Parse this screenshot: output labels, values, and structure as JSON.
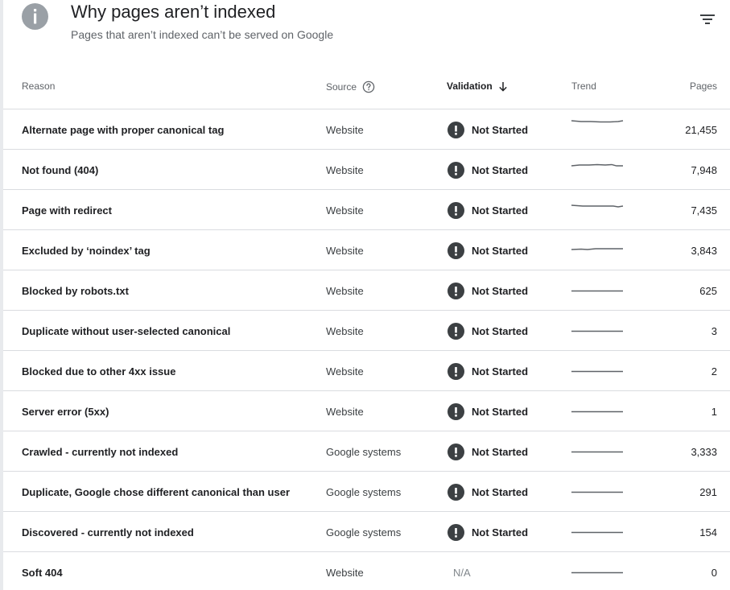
{
  "header": {
    "title": "Why pages aren’t indexed",
    "subtitle": "Pages that aren’t indexed can’t be served on Google",
    "info_icon": "info-icon",
    "filter_icon": "filter-icon"
  },
  "columns": {
    "reason": "Reason",
    "source": "Source",
    "validation": "Validation",
    "trend": "Trend",
    "pages": "Pages"
  },
  "colors": {
    "accent": "#202124",
    "muted": "#5f6368",
    "badge": "#3c4043",
    "icon_grey": "#9aa0a6",
    "divider": "#dadce0"
  },
  "rows": [
    {
      "reason": "Alternate page with proper canonical tag",
      "source": "Website",
      "validation": "Not Started",
      "pages": "21,455"
    },
    {
      "reason": "Not found (404)",
      "source": "Website",
      "validation": "Not Started",
      "pages": "7,948"
    },
    {
      "reason": "Page with redirect",
      "source": "Website",
      "validation": "Not Started",
      "pages": "7,435"
    },
    {
      "reason": "Excluded by ‘noindex’ tag",
      "source": "Website",
      "validation": "Not Started",
      "pages": "3,843"
    },
    {
      "reason": "Blocked by robots.txt",
      "source": "Website",
      "validation": "Not Started",
      "pages": "625"
    },
    {
      "reason": "Duplicate without user-selected canonical",
      "source": "Website",
      "validation": "Not Started",
      "pages": "3"
    },
    {
      "reason": "Blocked due to other 4xx issue",
      "source": "Website",
      "validation": "Not Started",
      "pages": "2"
    },
    {
      "reason": "Server error (5xx)",
      "source": "Website",
      "validation": "Not Started",
      "pages": "1"
    },
    {
      "reason": "Crawled - currently not indexed",
      "source": "Google systems",
      "validation": "Not Started",
      "pages": "3,333"
    },
    {
      "reason": "Duplicate, Google chose different canonical than user",
      "source": "Google systems",
      "validation": "Not Started",
      "pages": "291"
    },
    {
      "reason": "Discovered - currently not indexed",
      "source": "Google systems",
      "validation": "Not Started",
      "pages": "154"
    },
    {
      "reason": "Soft 404",
      "source": "Website",
      "validation": "N/A",
      "pages": "0"
    }
  ]
}
